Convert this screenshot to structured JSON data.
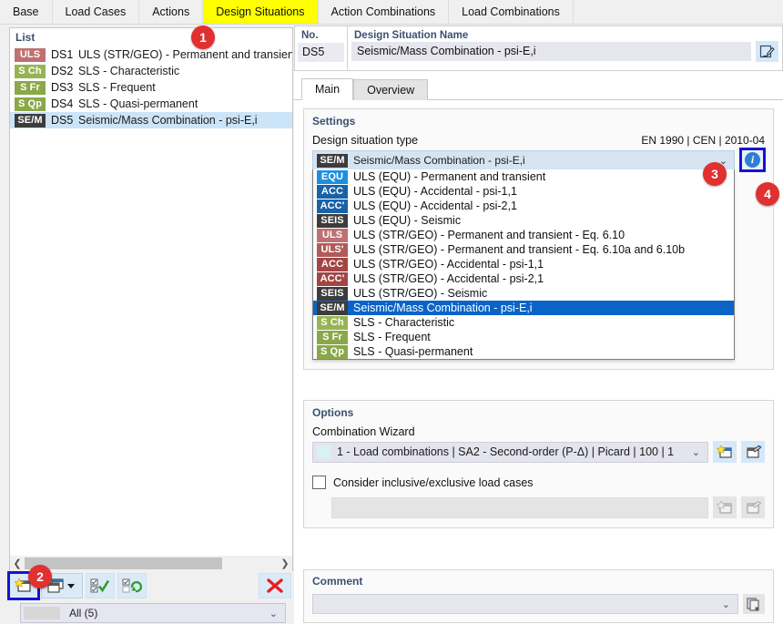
{
  "window": {
    "tabs": [
      {
        "label": "Base",
        "active": false
      },
      {
        "label": "Load Cases",
        "active": false
      },
      {
        "label": "Actions",
        "active": false
      },
      {
        "label": "Design Situations",
        "active": true
      },
      {
        "label": "Action Combinations",
        "active": false
      },
      {
        "label": "Load Combinations",
        "active": false
      }
    ]
  },
  "left": {
    "header": "List",
    "rows": [
      {
        "badge": "ULS",
        "badge_class": "b-uls",
        "no": "DS1",
        "name": "ULS (STR/GEO) - Permanent and transient - E",
        "selected": false
      },
      {
        "badge": "S Ch",
        "badge_class": "b-sch",
        "no": "DS2",
        "name": "SLS - Characteristic",
        "selected": false
      },
      {
        "badge": "S Fr",
        "badge_class": "b-sfr",
        "no": "DS3",
        "name": "SLS - Frequent",
        "selected": false
      },
      {
        "badge": "S Qp",
        "badge_class": "b-sqp",
        "no": "DS4",
        "name": "SLS - Quasi-permanent",
        "selected": false
      },
      {
        "badge": "SE/M",
        "badge_class": "b-sem",
        "no": "DS5",
        "name": "Seismic/Mass Combination - psi-E,i",
        "selected": true
      }
    ],
    "toolbar": {
      "new_button": "new-design-situation",
      "copy_button": "copy-design-situation",
      "select_all_button": "select-all",
      "invert_selection_button": "invert-selection",
      "delete_button": "delete-design-situation"
    },
    "filter": {
      "label": "All (5)"
    }
  },
  "right": {
    "no_caption": "No.",
    "no_value": "DS5",
    "name_caption": "Design Situation Name",
    "name_value": "Seismic/Mass Combination - psi-E,i",
    "inner_tabs": [
      {
        "label": "Main",
        "active": true
      },
      {
        "label": "Overview",
        "active": false
      }
    ],
    "settings": {
      "title": "Settings",
      "field_label": "Design situation type",
      "standard": "EN 1990 | CEN | 2010-04",
      "selected": {
        "badge": "SE/M",
        "badge_class": "b-sem",
        "label": "Seismic/Mass Combination - psi-E,i"
      },
      "options": [
        {
          "badge": "EQU",
          "badge_class": "b-equ",
          "label": "ULS (EQU) - Permanent and transient",
          "selected": false
        },
        {
          "badge": "ACC",
          "badge_class": "b-acc",
          "label": "ULS (EQU) - Accidental - psi-1,1",
          "selected": false
        },
        {
          "badge": "ACC'",
          "badge_class": "b-accp",
          "label": "ULS (EQU) - Accidental - psi-2,1",
          "selected": false
        },
        {
          "badge": "SEIS",
          "badge_class": "b-seis",
          "label": "ULS (EQU) - Seismic",
          "selected": false
        },
        {
          "badge": "ULS",
          "badge_class": "b-uls",
          "label": "ULS (STR/GEO) - Permanent and transient - Eq. 6.10",
          "selected": false
        },
        {
          "badge": "ULS'",
          "badge_class": "b-ulsp",
          "label": "ULS (STR/GEO) - Permanent and transient - Eq. 6.10a and 6.10b",
          "selected": false
        },
        {
          "badge": "ACC",
          "badge_class": "b-raccd",
          "label": "ULS (STR/GEO) - Accidental - psi-1,1",
          "selected": false
        },
        {
          "badge": "ACC'",
          "badge_class": "b-raccd",
          "label": "ULS (STR/GEO) - Accidental - psi-2,1",
          "selected": false
        },
        {
          "badge": "SEIS",
          "badge_class": "b-seis",
          "label": "ULS (STR/GEO) - Seismic",
          "selected": false
        },
        {
          "badge": "SE/M",
          "badge_class": "b-sem",
          "label": "Seismic/Mass Combination - psi-E,i",
          "selected": true
        },
        {
          "badge": "S Ch",
          "badge_class": "b-sch",
          "label": "SLS - Characteristic",
          "selected": false
        },
        {
          "badge": "S Fr",
          "badge_class": "b-sfr",
          "label": "SLS - Frequent",
          "selected": false
        },
        {
          "badge": "S Qp",
          "badge_class": "b-sqp",
          "label": "SLS - Quasi-permanent",
          "selected": false
        }
      ],
      "info_button": "info"
    },
    "options": {
      "title": "Options",
      "wizard_label": "Combination Wizard",
      "wizard_value": "1 - Load combinations | SA2 - Second-order (P-Δ) | Picard | 100 | 1",
      "checkbox_label": "Consider inclusive/exclusive load cases",
      "checkbox_checked": false
    },
    "comment": {
      "title": "Comment",
      "value": ""
    }
  },
  "markers": [
    {
      "id": "1",
      "label": "1"
    },
    {
      "id": "2",
      "label": "2"
    },
    {
      "id": "3",
      "label": "3"
    },
    {
      "id": "4",
      "label": "4"
    }
  ],
  "colors": {
    "accent_tab": "#ffff00",
    "marker": "#e03030",
    "selection": "#0a64c8",
    "list_selection": "#cce4f7",
    "focus_outline": "#1414d2"
  }
}
